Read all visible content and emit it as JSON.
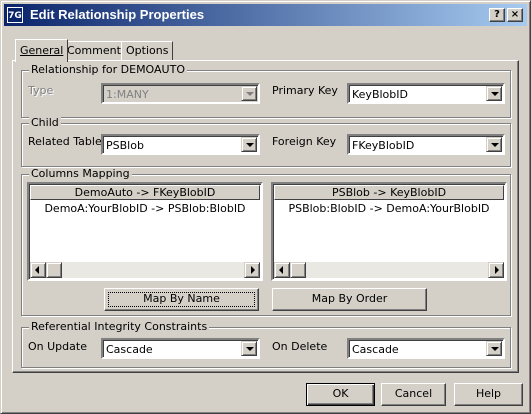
{
  "window": {
    "title": "Edit Relationship Properties",
    "icon_text": "7G"
  },
  "title_controls": {
    "help_label": "?",
    "close_label": "×"
  },
  "tabs": [
    {
      "label": "General",
      "selected": true
    },
    {
      "label": "Comments",
      "selected": false
    },
    {
      "label": "Options",
      "selected": false
    }
  ],
  "relationship_group": {
    "label": "Relationship for DEMOAUTO",
    "type_label": "Type",
    "type_value": "1:MANY",
    "primary_key_label": "Primary Key",
    "primary_key_value": "KeyBlobID"
  },
  "child_group": {
    "label": "Child",
    "related_table_label": "Related Table",
    "related_table_value": "PSBlob",
    "foreign_key_label": "Foreign Key",
    "foreign_key_value": "FKeyBlobID"
  },
  "columns_mapping": {
    "label": "Columns Mapping",
    "left_list": {
      "header": "DemoAuto  ->  FKeyBlobID",
      "rows": [
        "DemoA:YourBlobID  ->  PSBlob:BlobID"
      ]
    },
    "right_list": {
      "header": "PSBlob  ->  KeyBlobID",
      "rows": [
        "PSBlob:BlobID  ->  DemoA:YourBlobID"
      ]
    },
    "map_by_name_label": "Map By Name",
    "map_by_order_label": "Map By Order"
  },
  "integrity_group": {
    "label": "Referential Integrity Constraints",
    "on_update_label": "On Update",
    "on_update_value": "Cascade",
    "on_delete_label": "On Delete",
    "on_delete_value": "Cascade"
  },
  "footer": {
    "ok_label": "OK",
    "cancel_label": "Cancel",
    "help_label": "Help"
  },
  "colors": {
    "face": "#d4d0c8",
    "title_start": "#0a246a",
    "title_end": "#a6caf0",
    "shadow": "#808080"
  }
}
